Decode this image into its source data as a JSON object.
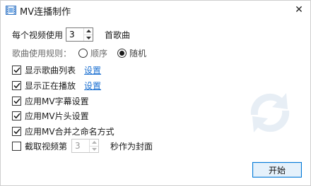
{
  "window": {
    "title": "MV连播制作",
    "close_glyph": "✕"
  },
  "videos_per": {
    "prefix": "每个视频使用",
    "value": "3",
    "suffix": "首歌曲"
  },
  "song_rule": {
    "label": "歌曲使用规则：",
    "options": [
      {
        "label": "顺序",
        "selected": false
      },
      {
        "label": "随机",
        "selected": true
      }
    ]
  },
  "checkboxes": [
    {
      "label": "显示歌曲列表",
      "checked": true,
      "link": "设置"
    },
    {
      "label": "显示正在播放",
      "checked": true,
      "link": "设置"
    },
    {
      "label": "应用MV字幕设置",
      "checked": true
    },
    {
      "label": "应用MV片头设置",
      "checked": true
    },
    {
      "label": "应用MV合并之命名方式",
      "checked": true
    }
  ],
  "cover": {
    "checked": false,
    "prefix": "截取视频第",
    "value": "3",
    "suffix": "秒作为封面"
  },
  "start_button": "开始",
  "icons": {
    "app": "film-icon",
    "watermark": "refresh-arrows-icon"
  },
  "colors": {
    "link": "#1a6fd1",
    "button_border": "#0078d7",
    "button_bg": "#e5f1fb"
  }
}
